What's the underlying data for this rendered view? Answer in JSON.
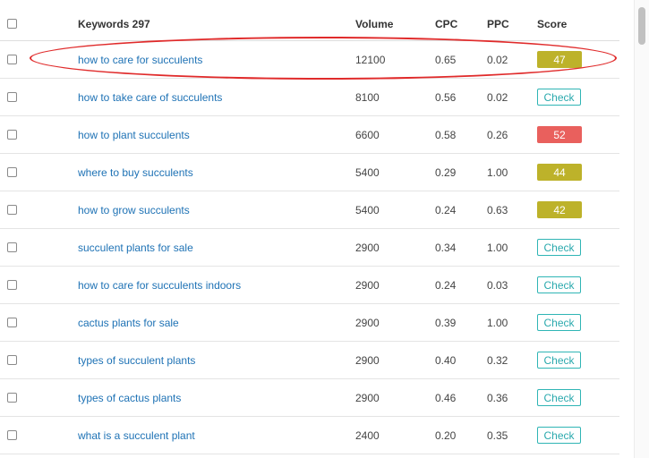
{
  "header": {
    "keywords_label": "Keywords 297",
    "volume_label": "Volume",
    "cpc_label": "CPC",
    "ppc_label": "PPC",
    "score_label": "Score"
  },
  "rows": [
    {
      "keyword": "how to care for succulents",
      "volume": "12100",
      "cpc": "0.65",
      "ppc": "0.02",
      "score": "47",
      "score_type": "badge",
      "score_color": "#bdb22a"
    },
    {
      "keyword": "how to take care of succulents",
      "volume": "8100",
      "cpc": "0.56",
      "ppc": "0.02",
      "score": "Check",
      "score_type": "button"
    },
    {
      "keyword": "how to plant succulents",
      "volume": "6600",
      "cpc": "0.58",
      "ppc": "0.26",
      "score": "52",
      "score_type": "badge",
      "score_color": "#e9605d"
    },
    {
      "keyword": "where to buy succulents",
      "volume": "5400",
      "cpc": "0.29",
      "ppc": "1.00",
      "score": "44",
      "score_type": "badge",
      "score_color": "#bdb22a"
    },
    {
      "keyword": "how to grow succulents",
      "volume": "5400",
      "cpc": "0.24",
      "ppc": "0.63",
      "score": "42",
      "score_type": "badge",
      "score_color": "#bdb22a"
    },
    {
      "keyword": "succulent plants for sale",
      "volume": "2900",
      "cpc": "0.34",
      "ppc": "1.00",
      "score": "Check",
      "score_type": "button"
    },
    {
      "keyword": "how to care for succulents indoors",
      "volume": "2900",
      "cpc": "0.24",
      "ppc": "0.03",
      "score": "Check",
      "score_type": "button"
    },
    {
      "keyword": "cactus plants for sale",
      "volume": "2900",
      "cpc": "0.39",
      "ppc": "1.00",
      "score": "Check",
      "score_type": "button"
    },
    {
      "keyword": "types of succulent plants",
      "volume": "2900",
      "cpc": "0.40",
      "ppc": "0.32",
      "score": "Check",
      "score_type": "button"
    },
    {
      "keyword": "types of cactus plants",
      "volume": "2900",
      "cpc": "0.46",
      "ppc": "0.36",
      "score": "Check",
      "score_type": "button"
    },
    {
      "keyword": "what is a succulent plant",
      "volume": "2400",
      "cpc": "0.20",
      "ppc": "0.35",
      "score": "Check",
      "score_type": "button"
    }
  ],
  "colors": {
    "link": "#1e72b5",
    "check_button": "#2aa9ad",
    "highlight_circle": "#e02b2b"
  }
}
